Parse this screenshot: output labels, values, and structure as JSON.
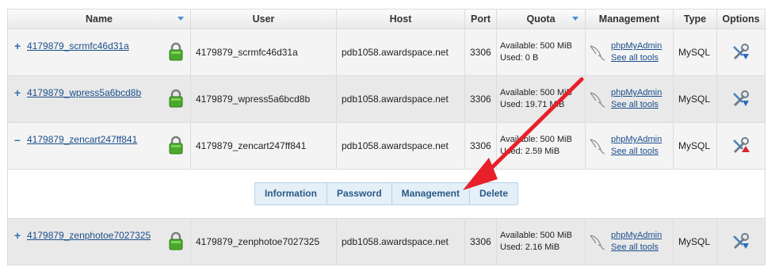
{
  "table": {
    "headers": {
      "name": "Name",
      "user": "User",
      "host": "Host",
      "port": "Port",
      "quota": "Quota",
      "management": "Management",
      "type": "Type",
      "options": "Options"
    },
    "rows": [
      {
        "expander": "+",
        "name": "4179879_scrmfc46d31a",
        "user": "4179879_scrmfc46d31a",
        "host": "pdb1058.awardspace.net",
        "port": "3306",
        "quota_available": "Available: 500 MiB",
        "quota_used": "Used: 0 B",
        "mgmt_primary": "phpMyAdmin",
        "mgmt_secondary": "See all tools",
        "type": "MySQL"
      },
      {
        "expander": "+",
        "name": "4179879_wpress5a6bcd8b",
        "user": "4179879_wpress5a6bcd8b",
        "host": "pdb1058.awardspace.net",
        "port": "3306",
        "quota_available": "Available: 500 MiB",
        "quota_used": "Used: 19.71 MiB",
        "mgmt_primary": "phpMyAdmin",
        "mgmt_secondary": "See all tools",
        "type": "MySQL"
      },
      {
        "expander": "–",
        "name": "4179879_zencart247ff841",
        "user": "4179879_zencart247ff841",
        "host": "pdb1058.awardspace.net",
        "port": "3306",
        "quota_available": "Available: 500 MiB",
        "quota_used": "Used: 2.59 MiB",
        "mgmt_primary": "phpMyAdmin",
        "mgmt_secondary": "See all tools",
        "type": "MySQL"
      },
      {
        "expander": "+",
        "name": "4179879_zenphotoe7027325",
        "user": "4179879_zenphotoe7027325",
        "host": "pdb1058.awardspace.net",
        "port": "3306",
        "quota_available": "Available: 500 MiB",
        "quota_used": "Used: 2.16 MiB",
        "mgmt_primary": "phpMyAdmin",
        "mgmt_secondary": "See all tools",
        "type": "MySQL"
      }
    ]
  },
  "expanded_actions": {
    "information": "Information",
    "password": "Password",
    "management": "Management",
    "delete": "Delete"
  },
  "icons": {
    "sort": "sort-down-icon",
    "lock": "lock-icon",
    "dolphin": "mysql-dolphin-icon",
    "tools": "tools-icon"
  },
  "colors": {
    "link": "#1a4e8a",
    "accent_blue": "#2d6fb3",
    "annotation_arrow": "#e8202a",
    "lock_green": "#4aa82c"
  }
}
